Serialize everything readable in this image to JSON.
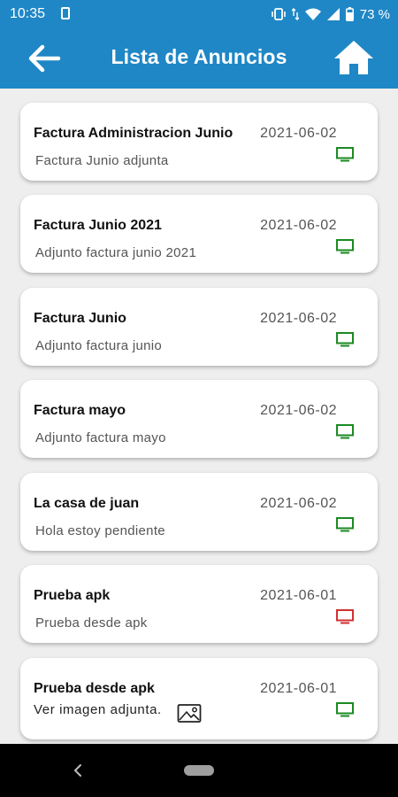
{
  "status_bar": {
    "time": "10:35",
    "battery_percent": "73 %",
    "icons": [
      "sim-card-icon",
      "vibrate-icon",
      "data-arrows-icon",
      "wifi-icon",
      "cell-signal-icon",
      "battery-icon"
    ]
  },
  "app_bar": {
    "title": "Lista de Anuncios",
    "back_icon": "arrow-left-icon",
    "home_icon": "home-icon",
    "color": "#1f87c6"
  },
  "announcements": [
    {
      "title": "Factura Administracion Junio",
      "date": "2021-06-02",
      "description": "Factura Junio adjunta",
      "status_icon": "tv-icon",
      "status_color": "#1b8a22"
    },
    {
      "title": "Factura Junio 2021",
      "date": "2021-06-02",
      "description": "Adjunto factura junio 2021",
      "status_icon": "tv-icon",
      "status_color": "#1b8a22"
    },
    {
      "title": "Factura Junio",
      "date": "2021-06-02",
      "description": "Adjunto factura junio",
      "status_icon": "tv-icon",
      "status_color": "#1b8a22"
    },
    {
      "title": "Factura mayo",
      "date": "2021-06-02",
      "description": "Adjunto factura mayo",
      "status_icon": "tv-icon",
      "status_color": "#1b8a22"
    },
    {
      "title": "La casa de juan",
      "date": "2021-06-02",
      "description": "Hola estoy pendiente",
      "status_icon": "tv-icon",
      "status_color": "#1b8a22"
    },
    {
      "title": "Prueba apk",
      "date": "2021-06-01",
      "description": "Prueba desde apk",
      "status_icon": "tv-icon",
      "status_color": "#d32f2f"
    },
    {
      "title": "Prueba desde apk",
      "date": "2021-06-01",
      "description": "Ver imagen adjunta.",
      "attachment_icon": "image-icon",
      "status_icon": "tv-icon",
      "status_color": "#1b8a22"
    }
  ],
  "nav_bar": {
    "back_icon": "nav-back-icon",
    "home_icon": "nav-home-pill"
  }
}
